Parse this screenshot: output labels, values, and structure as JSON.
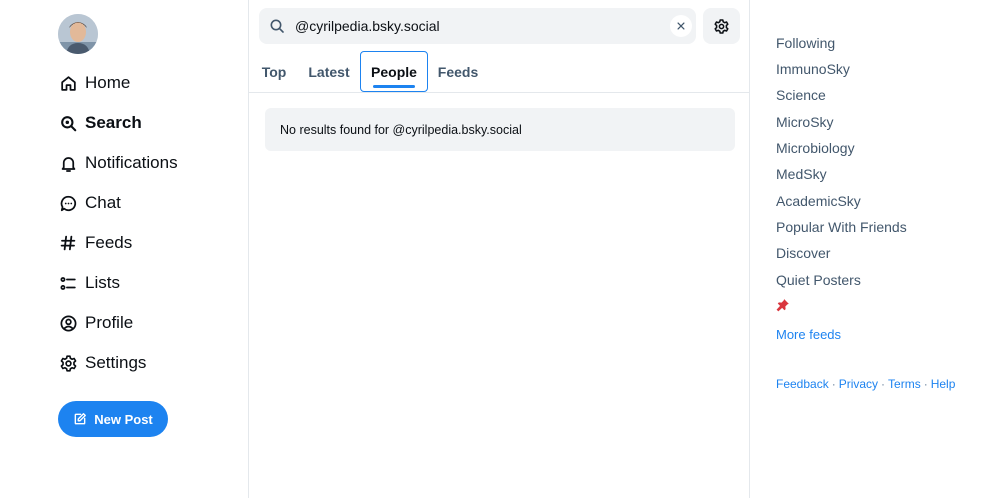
{
  "nav": {
    "items": [
      {
        "id": "home",
        "label": "Home",
        "icon": "home-icon"
      },
      {
        "id": "search",
        "label": "Search",
        "icon": "search-icon",
        "active": true
      },
      {
        "id": "notifications",
        "label": "Notifications",
        "icon": "bell-icon"
      },
      {
        "id": "chat",
        "label": "Chat",
        "icon": "chat-bubble-icon"
      },
      {
        "id": "feeds",
        "label": "Feeds",
        "icon": "hash-icon"
      },
      {
        "id": "lists",
        "label": "Lists",
        "icon": "list-icon"
      },
      {
        "id": "profile",
        "label": "Profile",
        "icon": "user-circle-icon"
      },
      {
        "id": "settings",
        "label": "Settings",
        "icon": "gear-icon"
      }
    ],
    "new_post_label": "New Post"
  },
  "search": {
    "value": "@cyrilpedia.bsky.social"
  },
  "tabs": [
    {
      "label": "Top"
    },
    {
      "label": "Latest"
    },
    {
      "label": "People",
      "active": true
    },
    {
      "label": "Feeds"
    }
  ],
  "results": {
    "empty_message": "No results found for @cyrilpedia.bsky.social"
  },
  "right": {
    "feeds": [
      "Following",
      "ImmunoSky",
      "Science",
      "MicroSky",
      "Microbiology",
      "MedSky",
      "AcademicSky",
      "Popular With Friends",
      "Discover",
      "Quiet Posters"
    ],
    "pin_icon": "pushpin-icon",
    "more_feeds_label": "More feeds",
    "footer": {
      "feedback": "Feedback",
      "privacy": "Privacy",
      "terms": "Terms",
      "help": "Help",
      "separator": "·"
    }
  },
  "colors": {
    "accent": "#1d83f0",
    "muted_text": "#42576c",
    "surface": "#f1f3f5",
    "border": "#e4e8ec",
    "pin": "#d9363e"
  }
}
